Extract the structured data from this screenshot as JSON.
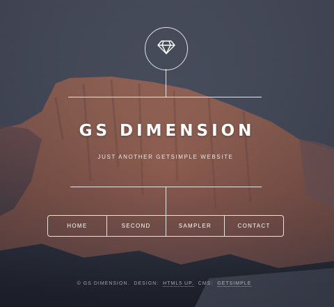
{
  "site": {
    "title": "GS DIMENSION",
    "tagline": "JUST ANOTHER GETSIMPLE WEBSITE"
  },
  "nav": {
    "items": [
      {
        "label": "HOME"
      },
      {
        "label": "SECOND"
      },
      {
        "label": "SAMPLER"
      },
      {
        "label": "CONTACT"
      }
    ]
  },
  "footer": {
    "copyright": "© GS DIMENSION.",
    "design_label": "DESIGN:",
    "design_link": "HTML5 UP.",
    "cms_label": "CMS:",
    "cms_link": "GETSIMPLE"
  },
  "icons": {
    "logo": "diamond-icon"
  },
  "colors": {
    "sky": "#4a5061",
    "rock": "#9a6a5a",
    "line": "#ffffff"
  }
}
